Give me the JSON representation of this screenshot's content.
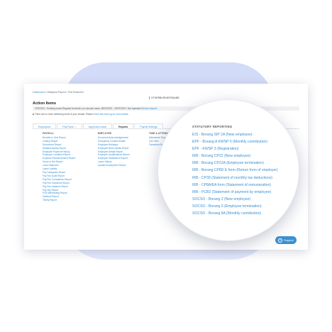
{
  "breadcrumb": {
    "root": "Dashboard",
    "separator": "/",
    "current": "Malaysia Payroll / Test Business"
  },
  "company_name": "OTHERBUSINESSNAME",
  "action_items": {
    "title": "Action Items",
    "row": "27/9/2021 - Pending Leave Request for Annie Luo, Annual Leave, 28/07/2021 - 29/07/2021 / Not repeated",
    "row_link": "Review request",
    "notice": "There are no more delivering some of your emails. Please",
    "notice_link": "check this help log for more details."
  },
  "tabs": [
    {
      "label": "Employees",
      "active": false
    },
    {
      "label": "Pay Runs",
      "active": false
    },
    {
      "label": "Approved Leave",
      "active": false
    },
    {
      "label": "Reports",
      "active": true
    },
    {
      "label": "Payroll Settings",
      "active": false
    }
  ],
  "payroll_reports": {
    "heading": "PAYROLL",
    "items": [
      "Benefits in Kind Report",
      "Costing Report",
      "Deductions Report",
      "Detailed Activity Report",
      "Employee Payment History",
      "Employee Condition Report",
      "Expense Reimbursement Report",
      "Gross to Net Report",
      "Leave Balances",
      "Leave Liability",
      "Pay Categories Report",
      "Pay Run Audit Report",
      "Pay Run Comparison Report",
      "Pay Run Inclusions Report",
      "Pay Run Variance Report",
      "Pay Slip Report",
      "PCB Withholding Report",
      "Variance Report",
      "Timely Report"
    ]
  },
  "employee_reports": {
    "heading": "EMPLOYEE",
    "items": [
      "Document Acknowledgements",
      "Emergency Contact Details",
      "Employee Birthdays",
      "Employee Bank Details Report",
      "Employee Details Report",
      "Employee Qualifications Report",
      "Employee Satisfaction Report",
      "Leave History",
      "Update Employment Report"
    ]
  },
  "other_reports": {
    "heading": "TIME & ATTENDANCE",
    "items": [
      "Attendance Report",
      "Live View",
      "Timesheet Report"
    ]
  },
  "statutory_reporting": {
    "heading": "STATUTORY REPORTING",
    "items": [
      "EIS - Borang SIP 2A (New employee)",
      "EPF - Borang A KWSP 6 (Monthly contribution)",
      "EPF - KWSP 3 (Registration)",
      "IRB - Borang CP22 (New employee)",
      "IRB - Borang CP22A (Employee termination)",
      "IRB - Borang CP8D E form (Return form of employer)",
      "IRB - CP39 (Statement of monthly tax deductions)",
      "IRB - CP8A/EA form (Statement of remuneration)",
      "IRB - PCB2 (Statement of payment by employee)",
      "SOCSO - Borang 2 (New employee)",
      "SOCSO - Borang 3 (Employee termination)",
      "SOCSO - Borang 8A (Monthly contribution)"
    ]
  },
  "support": {
    "label": "Support",
    "icon": "question-icon"
  },
  "colors": {
    "accent": "#3b8fd1",
    "background_blob": "#c9d4f6"
  }
}
